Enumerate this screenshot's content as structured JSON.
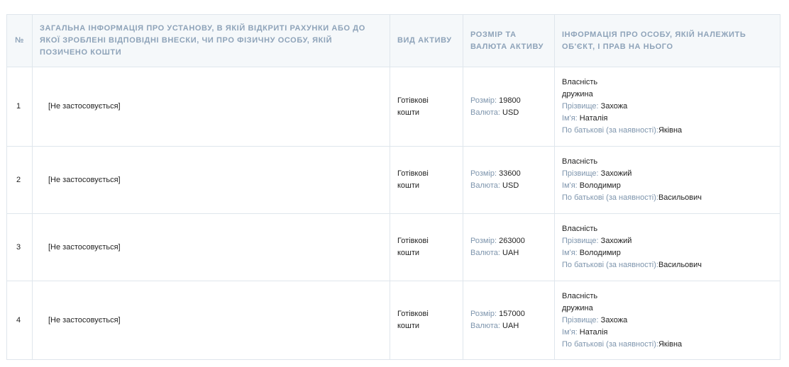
{
  "table": {
    "headers": {
      "num": "№",
      "institution": "ЗАГАЛЬНА ІНФОРМАЦІЯ ПРО УСТАНОВУ, В ЯКІЙ ВІДКРИТІ РАХУНКИ АБО ДО ЯКОЇ ЗРОБЛЕНІ ВІДПОВІДНІ ВНЕСКИ, ЧИ ПРО ФІЗИЧНУ ОСОБУ, ЯКІЙ ПОЗИЧЕНО КОШТИ",
      "asset_type": "ВИД АКТИВУ",
      "size_currency": "РОЗМІР ТА ВАЛЮТА АКТИВУ",
      "owner_info": "ІНФОРМАЦІЯ ПРО ОСОБУ, ЯКІЙ НАЛЕЖИТЬ ОБ'ЄКТ, І ПРАВ НА НЬОГО"
    },
    "labels": {
      "size": "Розмір:",
      "currency": "Валюта:",
      "surname": "Прізвище:",
      "name": "Ім'я:",
      "patronymic": "По батькові (за наявності):"
    },
    "rows": [
      {
        "num": "1",
        "institution": "[Не застосовується]",
        "asset_type": "Готівкові кошти",
        "size": "19800",
        "currency": "USD",
        "right": "Власність",
        "relation": "дружина",
        "surname": "Захожа",
        "name": "Наталія",
        "patronymic": "Яківна"
      },
      {
        "num": "2",
        "institution": "[Не застосовується]",
        "asset_type": "Готівкові кошти",
        "size": "33600",
        "currency": "USD",
        "right": "Власність",
        "surname": "Захожий",
        "name": "Володимир",
        "patronymic": "Васильович"
      },
      {
        "num": "3",
        "institution": "[Не застосовується]",
        "asset_type": "Готівкові кошти",
        "size": "263000",
        "currency": "UAH",
        "right": "Власність",
        "surname": "Захожий",
        "name": "Володимир",
        "patronymic": "Васильович"
      },
      {
        "num": "4",
        "institution": "[Не застосовується]",
        "asset_type": "Готівкові кошти",
        "size": "157000",
        "currency": "UAH",
        "right": "Власність",
        "relation": "дружина",
        "surname": "Захожа",
        "name": "Наталія",
        "patronymic": "Яківна"
      }
    ]
  }
}
